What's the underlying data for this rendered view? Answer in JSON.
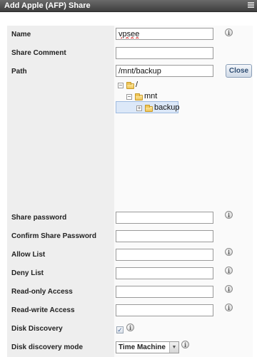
{
  "window": {
    "title": "Add Apple (AFP) Share",
    "menu_icon": "menu-icon"
  },
  "fields": {
    "name": {
      "label": "Name",
      "value": "vpsee"
    },
    "share_comment": {
      "label": "Share Comment",
      "value": ""
    },
    "path": {
      "label": "Path",
      "value": "/mnt/backup"
    },
    "share_password": {
      "label": "Share password",
      "value": ""
    },
    "confirm_share_password": {
      "label": "Confirm Share Password",
      "value": ""
    },
    "allow_list": {
      "label": "Allow List",
      "value": ""
    },
    "deny_list": {
      "label": "Deny List",
      "value": ""
    },
    "read_only_access": {
      "label": "Read-only Access",
      "value": ""
    },
    "read_write_access": {
      "label": "Read-write Access",
      "value": ""
    },
    "disk_discovery": {
      "label": "Disk Discovery",
      "checked": true
    },
    "disk_discovery_mode": {
      "label": "Disk discovery mode",
      "selected": "Time Machine"
    }
  },
  "path_browser": {
    "close_label": "Close",
    "tree": [
      {
        "label": "/",
        "expanded": true,
        "expander": "−"
      },
      {
        "label": "mnt",
        "expanded": true,
        "expander": "−"
      },
      {
        "label": "backup",
        "expanded": false,
        "expander": "+",
        "selected": true
      }
    ]
  },
  "help_icon": "info-icon",
  "help_glyph": "i",
  "colors": {
    "titlebar": "#4f4f4f",
    "label_column": "#eeeeee",
    "selection": "#dce8f8",
    "close_button_text": "#2e4d73"
  }
}
